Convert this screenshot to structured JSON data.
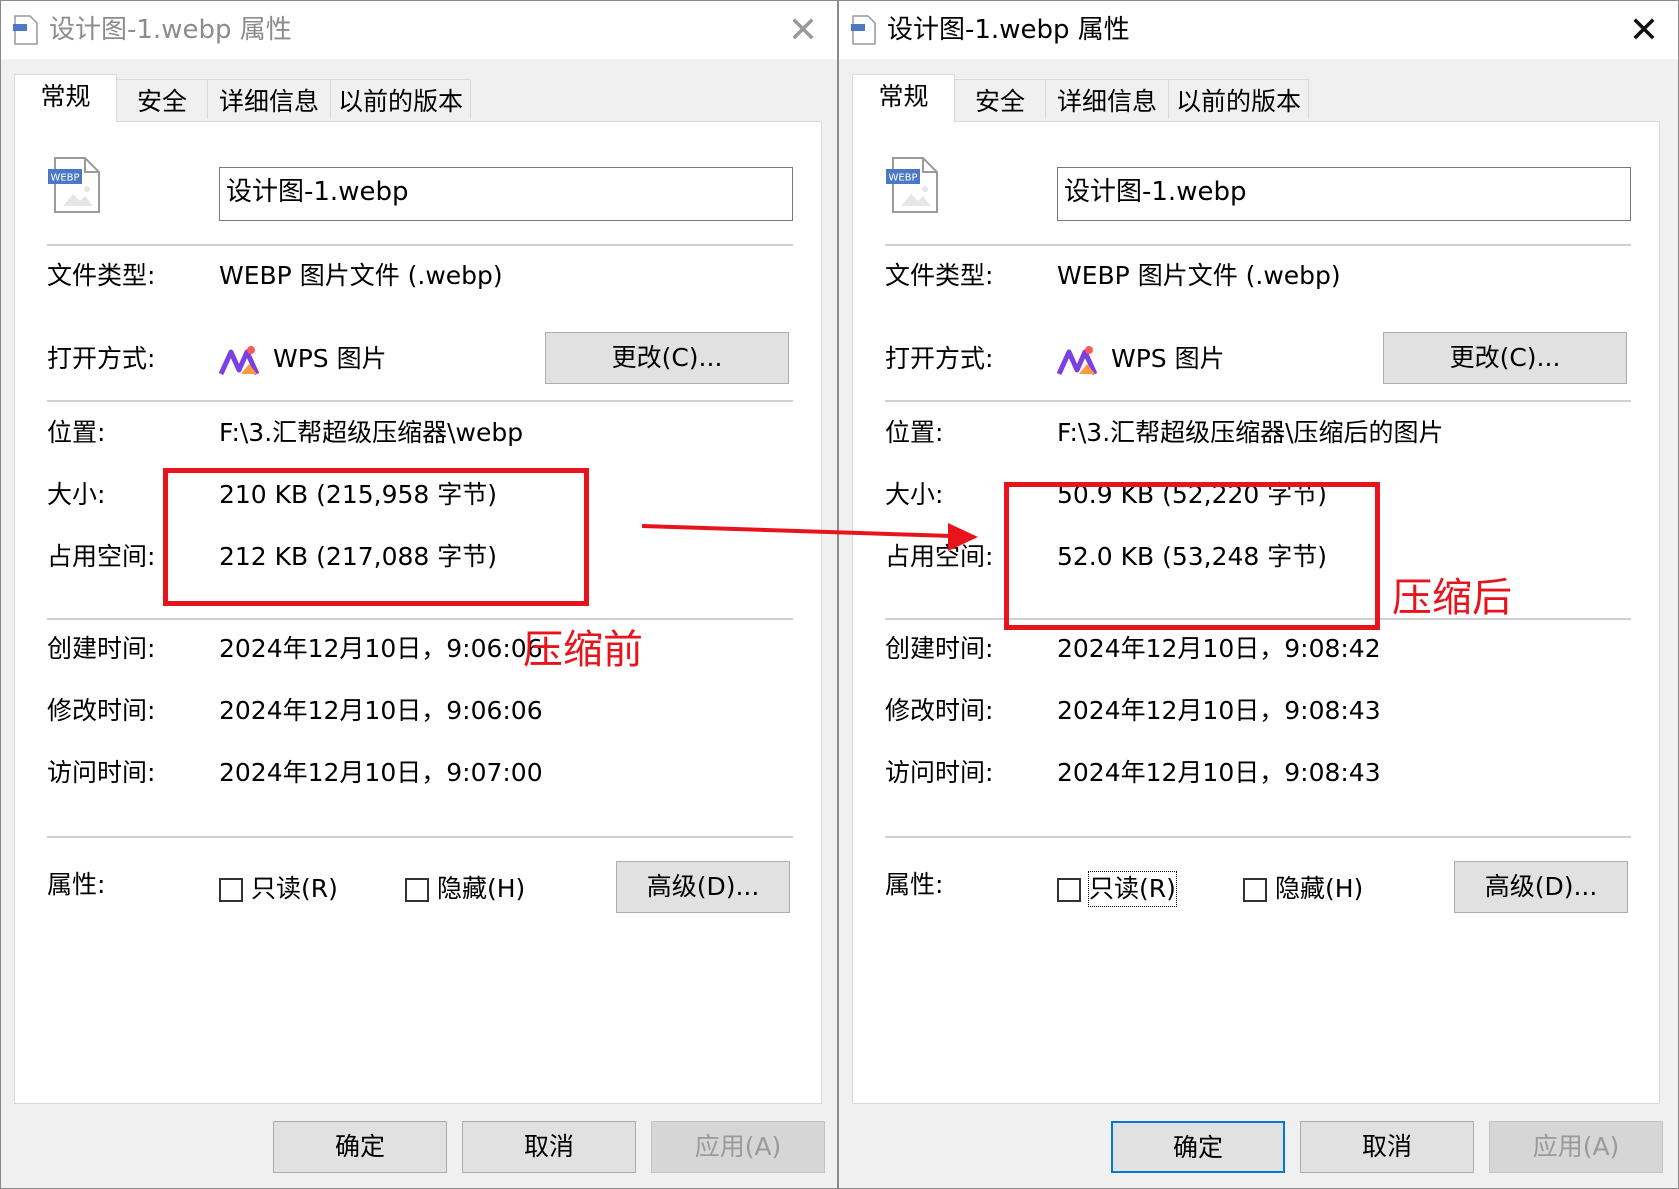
{
  "left": {
    "title": "设计图-1.webp 属性",
    "close": "✕",
    "tabs": [
      "常规",
      "安全",
      "详细信息",
      "以前的版本"
    ],
    "file_icon_label": "WEBP",
    "filename": "设计图-1.webp",
    "fields": {
      "type_label": "文件类型:",
      "type_value": "WEBP 图片文件 (.webp)",
      "open_label": "打开方式:",
      "open_value": "WPS 图片",
      "change_button": "更改(C)...",
      "location_label": "位置:",
      "location_value": "F:\\3.汇帮超级压缩器\\webp",
      "size_label": "大小:",
      "size_value": "210 KB (215,958 字节)",
      "disk_label": "占用空间:",
      "disk_value": "212 KB (217,088 字节)",
      "created_label": "创建时间:",
      "created_value": "2024年12月10日，9:06:06",
      "modified_label": "修改时间:",
      "modified_value": "2024年12月10日，9:06:06",
      "accessed_label": "访问时间:",
      "accessed_value": "2024年12月10日，9:07:00",
      "attr_label": "属性:",
      "readonly": "只读(R)",
      "hidden": "隐藏(H)",
      "advanced_button": "高级(D)..."
    },
    "buttons": {
      "ok": "确定",
      "cancel": "取消",
      "apply": "应用(A)"
    },
    "annotation": "压缩前"
  },
  "right": {
    "title": "设计图-1.webp 属性",
    "close": "✕",
    "tabs": [
      "常规",
      "安全",
      "详细信息",
      "以前的版本"
    ],
    "file_icon_label": "WEBP",
    "filename": "设计图-1.webp",
    "fields": {
      "type_label": "文件类型:",
      "type_value": "WEBP 图片文件 (.webp)",
      "open_label": "打开方式:",
      "open_value": "WPS 图片",
      "change_button": "更改(C)...",
      "location_label": "位置:",
      "location_value": "F:\\3.汇帮超级压缩器\\压缩后的图片",
      "size_label": "大小:",
      "size_value": "50.9 KB (52,220 字节)",
      "disk_label": "占用空间:",
      "disk_value": "52.0 KB (53,248 字节)",
      "created_label": "创建时间:",
      "created_value": "2024年12月10日，9:08:42",
      "modified_label": "修改时间:",
      "modified_value": "2024年12月10日，9:08:43",
      "accessed_label": "访问时间:",
      "accessed_value": "2024年12月10日，9:08:43",
      "attr_label": "属性:",
      "readonly": "只读(R)",
      "hidden": "隐藏(H)",
      "advanced_button": "高级(D)..."
    },
    "buttons": {
      "ok": "确定",
      "cancel": "取消",
      "apply": "应用(A)"
    },
    "annotation": "压缩后"
  },
  "colors": {
    "annotation_red": "#e8141c",
    "focus_blue": "#0078d7"
  }
}
